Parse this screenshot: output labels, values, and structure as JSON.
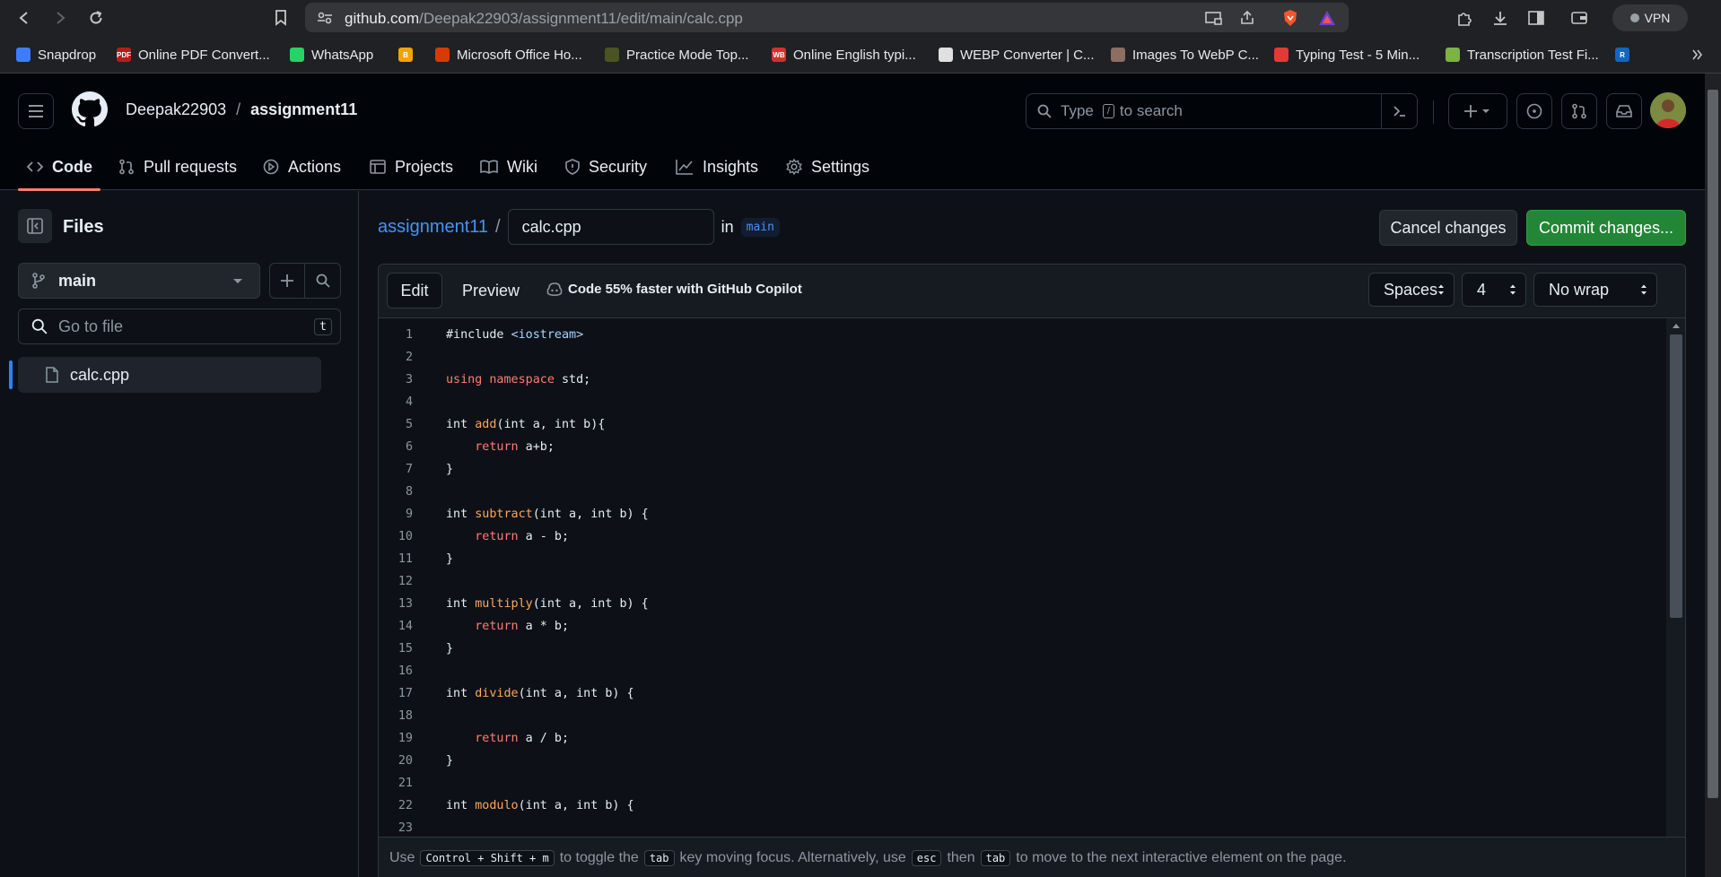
{
  "browser": {
    "url_host": "github.com",
    "url_path": "/Deepak22903/assignment11/edit/main/calc.cpp",
    "vpn_label": "VPN",
    "bookmarks": [
      {
        "label": "Snapdrop",
        "color": "#3d7cff",
        "badge": ""
      },
      {
        "label": "Online PDF Convert...",
        "color": "#b71c1c",
        "badge": "PDF"
      },
      {
        "label": "WhatsApp",
        "color": "#25d366",
        "badge": ""
      },
      {
        "label": "",
        "color": "#f4a300",
        "badge": "B"
      },
      {
        "label": "Microsoft Office Ho...",
        "color": "#d83b01",
        "badge": ""
      },
      {
        "label": "Practice Mode Top...",
        "color": "#4b5320",
        "badge": ""
      },
      {
        "label": "Online English typi...",
        "color": "#d32f2f",
        "badge": "WB"
      },
      {
        "label": "WEBP Converter | C...",
        "color": "#e0e0e0",
        "badge": ""
      },
      {
        "label": "Images To WebP C...",
        "color": "#8d6e63",
        "badge": ""
      },
      {
        "label": "Typing Test - 5 Min...",
        "color": "#e53935",
        "badge": ""
      },
      {
        "label": "Transcription Test Fi...",
        "color": "#7cb342",
        "badge": ""
      },
      {
        "label": "",
        "color": "#1565c0",
        "badge": "R"
      }
    ]
  },
  "header": {
    "owner": "Deepak22903",
    "separator": "/",
    "repo": "assignment11",
    "search_prefix": "Type",
    "search_key": "/",
    "search_suffix": "to search",
    "tabs": [
      {
        "label": "Code",
        "icon": "code-icon"
      },
      {
        "label": "Pull requests",
        "icon": "git-pull-request-icon"
      },
      {
        "label": "Actions",
        "icon": "play-icon"
      },
      {
        "label": "Projects",
        "icon": "table-icon"
      },
      {
        "label": "Wiki",
        "icon": "book-icon"
      },
      {
        "label": "Security",
        "icon": "shield-icon"
      },
      {
        "label": "Insights",
        "icon": "graph-icon"
      },
      {
        "label": "Settings",
        "icon": "gear-icon"
      }
    ]
  },
  "sidebar": {
    "title": "Files",
    "branch": "main",
    "goto_placeholder": "Go to file",
    "goto_key": "t",
    "files": [
      {
        "name": "calc.cpp",
        "selected": true
      }
    ]
  },
  "editor": {
    "breadcrumb_repo": "assignment11",
    "breadcrumb_sep": "/",
    "filename": "calc.cpp",
    "in_label": "in",
    "branch": "main",
    "cancel_label": "Cancel changes",
    "commit_label": "Commit changes...",
    "tab_edit": "Edit",
    "tab_preview": "Preview",
    "copilot_promo": "Code 55% faster with GitHub Copilot",
    "indent_mode": "Spaces",
    "indent_size": "4",
    "wrap_mode": "No wrap",
    "lines": [
      {
        "n": "1",
        "tokens": [
          [
            "#include ",
            "p"
          ],
          [
            "<iostream>",
            "inc"
          ]
        ]
      },
      {
        "n": "2",
        "tokens": []
      },
      {
        "n": "3",
        "tokens": [
          [
            "using",
            "kw"
          ],
          [
            " ",
            "p"
          ],
          [
            "namespace",
            "kw"
          ],
          [
            " std;",
            "p"
          ]
        ]
      },
      {
        "n": "4",
        "tokens": []
      },
      {
        "n": "5",
        "tokens": [
          [
            "int ",
            "p"
          ],
          [
            "add",
            "fn"
          ],
          [
            "(int a, int b){",
            "p"
          ]
        ]
      },
      {
        "n": "6",
        "tokens": [
          [
            "    ",
            "p"
          ],
          [
            "return",
            "kw"
          ],
          [
            " a+b;",
            "p"
          ]
        ]
      },
      {
        "n": "7",
        "tokens": [
          [
            "}",
            "p"
          ]
        ]
      },
      {
        "n": "8",
        "tokens": []
      },
      {
        "n": "9",
        "tokens": [
          [
            "int ",
            "p"
          ],
          [
            "subtract",
            "fn"
          ],
          [
            "(int a, int b) {",
            "p"
          ]
        ]
      },
      {
        "n": "10",
        "tokens": [
          [
            "    ",
            "p"
          ],
          [
            "return",
            "kw"
          ],
          [
            " a - b;",
            "p"
          ]
        ]
      },
      {
        "n": "11",
        "tokens": [
          [
            "}",
            "p"
          ]
        ]
      },
      {
        "n": "12",
        "tokens": []
      },
      {
        "n": "13",
        "tokens": [
          [
            "int ",
            "p"
          ],
          [
            "multiply",
            "fn"
          ],
          [
            "(int a, int b) {",
            "p"
          ]
        ]
      },
      {
        "n": "14",
        "tokens": [
          [
            "    ",
            "p"
          ],
          [
            "return",
            "kw"
          ],
          [
            " a * b;",
            "p"
          ]
        ]
      },
      {
        "n": "15",
        "tokens": [
          [
            "}",
            "p"
          ]
        ]
      },
      {
        "n": "16",
        "tokens": []
      },
      {
        "n": "17",
        "tokens": [
          [
            "int ",
            "p"
          ],
          [
            "divide",
            "fn"
          ],
          [
            "(int a, int b) {",
            "p"
          ]
        ]
      },
      {
        "n": "18",
        "tokens": []
      },
      {
        "n": "19",
        "tokens": [
          [
            "    ",
            "p"
          ],
          [
            "return",
            "kw"
          ],
          [
            " a / b;",
            "p"
          ]
        ]
      },
      {
        "n": "20",
        "tokens": [
          [
            "}",
            "p"
          ]
        ]
      },
      {
        "n": "21",
        "tokens": []
      },
      {
        "n": "22",
        "tokens": [
          [
            "int ",
            "p"
          ],
          [
            "modulo",
            "fn"
          ],
          [
            "(int a, int b) {",
            "p"
          ]
        ]
      },
      {
        "n": "23",
        "tokens": []
      }
    ],
    "status": {
      "t1": "Use",
      "k1": "Control + Shift + m",
      "t2": "to toggle the",
      "k2": "tab",
      "t3": "key moving focus. Alternatively, use",
      "k3": "esc",
      "t4": "then",
      "k4": "tab",
      "t5": "to move to the next interactive element on the page."
    }
  },
  "colors": {
    "accent_underline": "#f78166",
    "commit_green": "#238636",
    "link_blue": "#4493f8",
    "keyword": "#ff7b72",
    "function": "#ffa657",
    "include_string": "#a5d6ff"
  }
}
